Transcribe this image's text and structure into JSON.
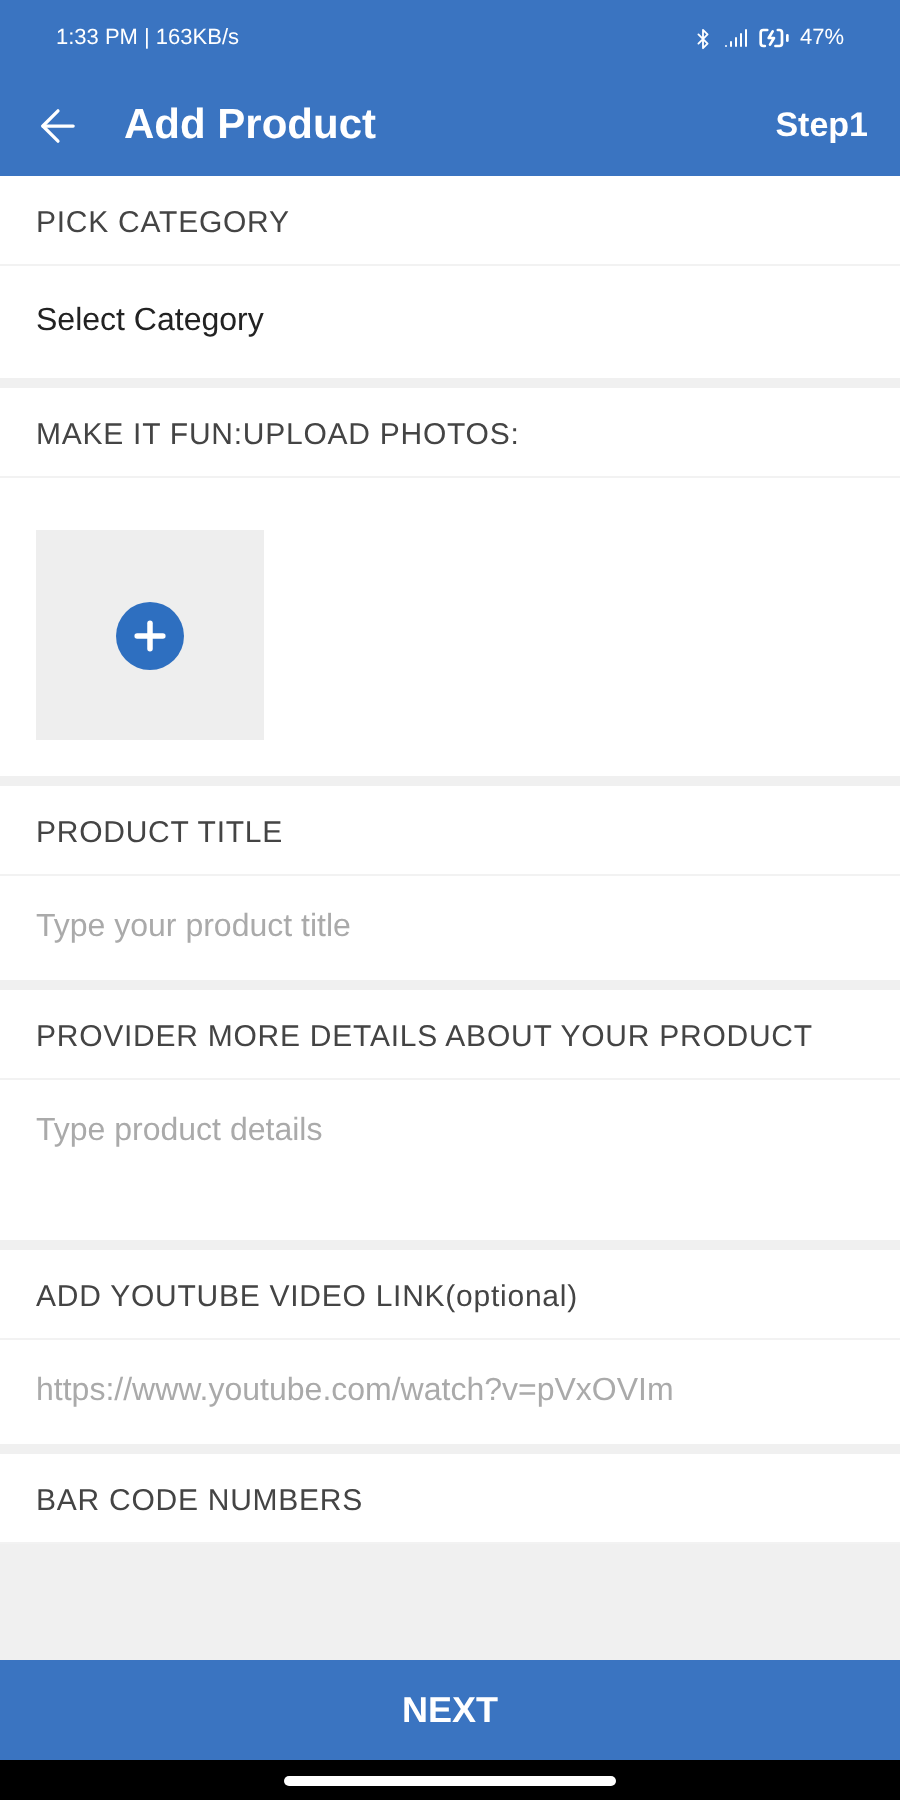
{
  "status_bar": {
    "time": "1:33 PM | 163KB/s",
    "battery": "47%"
  },
  "header": {
    "title": "Add Product",
    "step": "Step1"
  },
  "sections": [
    {
      "kind": "select",
      "label": "PICK CATEGORY",
      "value": "Select Category"
    },
    {
      "kind": "photos",
      "label": "MAKE IT FUN:UPLOAD PHOTOS:"
    },
    {
      "kind": "input",
      "label": "PRODUCT TITLE",
      "placeholder": "Type your product title"
    },
    {
      "kind": "textarea",
      "label": "PROVIDER MORE DETAILS ABOUT YOUR PRODUCT",
      "placeholder": "Type product details"
    },
    {
      "kind": "input",
      "label": "ADD YOUTUBE VIDEO LINK(optional)",
      "placeholder": "https://www.youtube.com/watch?v=pVxOVIm"
    },
    {
      "kind": "label",
      "label": "BAR CODE NUMBERS"
    }
  ],
  "footer": {
    "button": "NEXT"
  }
}
